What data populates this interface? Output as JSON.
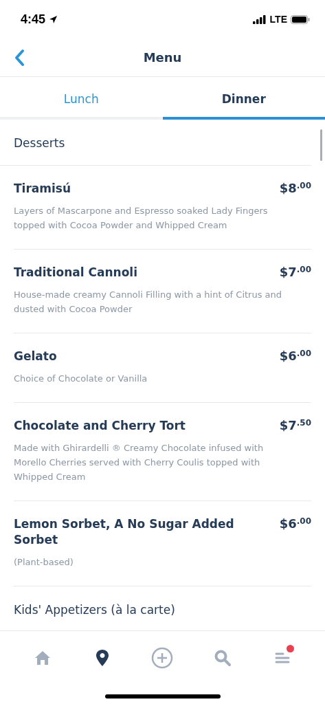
{
  "status_bar": {
    "time": "4:45",
    "network": "LTE"
  },
  "header": {
    "title": "Menu"
  },
  "tabs": [
    {
      "label": "Lunch",
      "selected": false
    },
    {
      "label": "Dinner",
      "selected": true
    }
  ],
  "sections": [
    {
      "title": "Desserts",
      "items": [
        {
          "name": "Tiramisú",
          "price_main": "$8",
          "price_cents": ".00",
          "description": "Layers of Mascarpone and Espresso soaked Lady Fingers topped with Cocoa Powder and Whipped Cream"
        },
        {
          "name": "Traditional Cannoli",
          "price_main": "$7",
          "price_cents": ".00",
          "description": "House-made creamy Cannoli Filling with a hint of Citrus and dusted with Cocoa Powder"
        },
        {
          "name": "Gelato",
          "price_main": "$6",
          "price_cents": ".00",
          "description": "Choice of Chocolate or Vanilla"
        },
        {
          "name": "Chocolate and Cherry Tort",
          "price_main": "$7",
          "price_cents": ".50",
          "description": "Made with Ghirardelli ® Creamy Chocolate infused with Morello Cherries served with Cherry Coulis topped with Whipped Cream"
        },
        {
          "name": "Lemon Sorbet,  A No Sugar Added Sorbet",
          "price_main": "$6",
          "price_cents": ".00",
          "description": "(Plant-based)"
        }
      ]
    },
    {
      "title": "Kids' Appetizers (à la carte)"
    }
  ],
  "bottom_nav": [
    {
      "kind": "home",
      "selected": false,
      "badge": false
    },
    {
      "kind": "location",
      "selected": true,
      "badge": false
    },
    {
      "kind": "add",
      "selected": false,
      "badge": false
    },
    {
      "kind": "search",
      "selected": false,
      "badge": false
    },
    {
      "kind": "menu",
      "selected": false,
      "badge": true
    }
  ]
}
